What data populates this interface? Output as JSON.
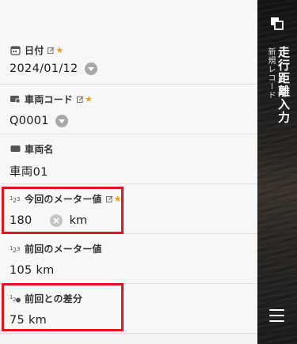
{
  "fields": {
    "date": {
      "label": "日付",
      "value": "2024/01/12",
      "required_mark": "★"
    },
    "vehicle_code": {
      "label": "車両コード",
      "value": "Q0001",
      "required_mark": "★"
    },
    "vehicle_name": {
      "label": "車両名",
      "value": "車両01"
    },
    "current_meter": {
      "label": "今回のメーター値",
      "value": "180",
      "unit": "km",
      "required_mark": "★"
    },
    "previous_meter": {
      "label": "前回のメーター値",
      "value": "105 km"
    },
    "difference": {
      "label": "前回との差分",
      "value": "75 km"
    }
  },
  "sidebar": {
    "title": "走行距離入力",
    "subtitle": "新規レコード",
    "copy_icon": "copy-icon",
    "menu_icon": "hamburger-menu-icon"
  },
  "colors": {
    "highlight": "#e0161f",
    "required_star": "#f29a12",
    "sidebar_bg": "#1e1e1e"
  }
}
